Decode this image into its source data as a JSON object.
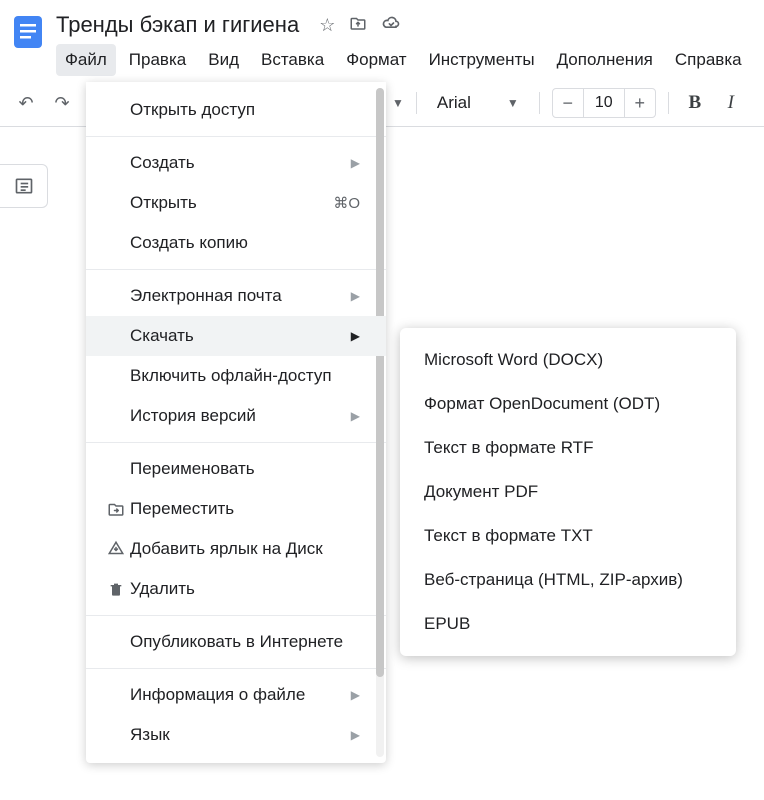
{
  "document": {
    "title": "Тренды бэкап и гигиена"
  },
  "menubar": [
    "Файл",
    "Правка",
    "Вид",
    "Вставка",
    "Формат",
    "Инструменты",
    "Дополнения",
    "Справка"
  ],
  "toolbar": {
    "font": "Arial",
    "size": "10"
  },
  "fileMenu": {
    "share": "Открыть доступ",
    "new": "Создать",
    "open": "Открыть",
    "openShortcut": "⌘O",
    "makeCopy": "Создать копию",
    "email": "Электронная почта",
    "download": "Скачать",
    "offline": "Включить офлайн-доступ",
    "versionHistory": "История версий",
    "rename": "Переименовать",
    "move": "Переместить",
    "addShortcut": "Добавить ярлык на Диск",
    "delete": "Удалить",
    "publish": "Опубликовать в Интернете",
    "info": "Информация о файле",
    "language": "Язык"
  },
  "downloadMenu": [
    "Microsoft Word (DOCX)",
    "Формат OpenDocument (ODT)",
    "Текст в формате RTF",
    "Документ PDF",
    "Текст в формате TXT",
    "Веб-страница (HTML, ZIP-архив)",
    "EPUB"
  ]
}
